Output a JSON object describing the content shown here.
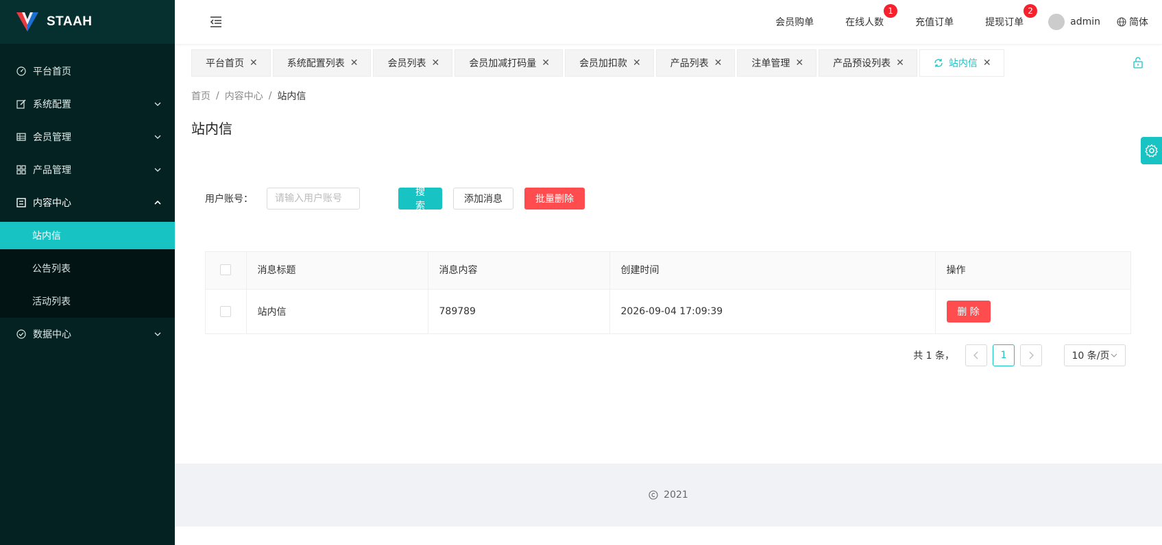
{
  "brand": {
    "name": "STAAH",
    "accent": "#17c3c3",
    "sidebar_bg": "#042222"
  },
  "sidebar": {
    "items": [
      {
        "label": "平台首页",
        "icon": "dashboard-icon"
      },
      {
        "label": "系统配置",
        "icon": "edit-icon"
      },
      {
        "label": "会员管理",
        "icon": "table-icon"
      },
      {
        "label": "产品管理",
        "icon": "appstore-icon"
      },
      {
        "label": "内容中心",
        "icon": "profile-icon"
      },
      {
        "label": "数据中心",
        "icon": "check-circle-icon"
      }
    ],
    "content_sub": [
      {
        "label": "站内信"
      },
      {
        "label": "公告列表"
      },
      {
        "label": "活动列表"
      }
    ]
  },
  "header": {
    "links": [
      {
        "label": "会员购单"
      },
      {
        "label": "在线人数",
        "badge": "1"
      },
      {
        "label": "充值订单"
      },
      {
        "label": "提现订单",
        "badge": "2"
      }
    ],
    "user": "admin",
    "lang": "简体"
  },
  "tabs": [
    {
      "label": "平台首页"
    },
    {
      "label": "系统配置列表"
    },
    {
      "label": "会员列表"
    },
    {
      "label": "会员加减打码量"
    },
    {
      "label": "会员加扣款"
    },
    {
      "label": "产品列表"
    },
    {
      "label": "注单管理"
    },
    {
      "label": "产品预设列表"
    },
    {
      "label": "站内信"
    }
  ],
  "breadcrumb": {
    "home": "首页",
    "parent": "内容中心",
    "current": "站内信"
  },
  "page": {
    "title": "站内信"
  },
  "filter": {
    "label": "用户账号：",
    "placeholder": "请输入用户账号",
    "search_label": "搜 索",
    "add_label": "添加消息",
    "batch_delete_label": "批量删除"
  },
  "table": {
    "columns": [
      "消息标题",
      "消息内容",
      "创建时间",
      "操作"
    ],
    "rows": [
      {
        "title": "站内信",
        "content": "789789",
        "created": "2026-09-04 17:09:39",
        "action": "删 除"
      }
    ]
  },
  "pagination": {
    "total": "共 1 条，",
    "current": "1",
    "page_size": "10 条/页"
  },
  "footer": {
    "text": "2021"
  }
}
